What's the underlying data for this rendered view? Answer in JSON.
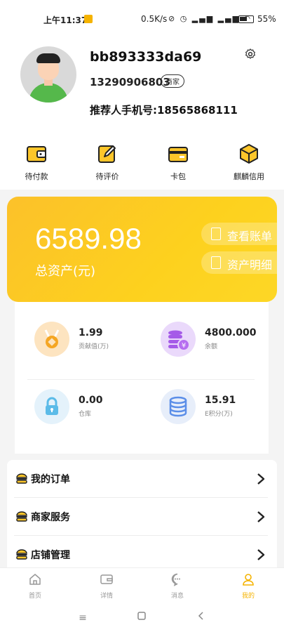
{
  "status_bar": {
    "time": "上午11:37",
    "network_speed": "0.5K/s",
    "battery": "55%"
  },
  "profile": {
    "username": "bb893333da69",
    "phone": "13290906803",
    "role_badge": "商家",
    "referrer": "推荐人手机号:18565868111"
  },
  "quick_actions": [
    {
      "label": "待付款",
      "icon": "wallet-icon"
    },
    {
      "label": "待评价",
      "icon": "edit-icon"
    },
    {
      "label": "卡包",
      "icon": "card-icon"
    },
    {
      "label": "麒麟信用",
      "icon": "box-icon"
    }
  ],
  "assets": {
    "total": "6589.98",
    "caption": "总资产(元)",
    "view_bill": "查看账单",
    "asset_detail": "资产明细"
  },
  "stats": [
    {
      "value": "1.99",
      "label": "贡献值(万)",
      "icon": "medal-icon",
      "color": "#fde4c0"
    },
    {
      "value": "4800.000",
      "label": "余额",
      "icon": "coins-icon",
      "color": "#ead9fb"
    },
    {
      "value": "0.00",
      "label": "仓库",
      "icon": "lock-icon",
      "color": "#e4f2fb"
    },
    {
      "value": "15.91",
      "label": "E积分(万)",
      "icon": "database-icon",
      "color": "#e7eefa"
    }
  ],
  "menu": [
    {
      "label": "我的订单"
    },
    {
      "label": "商家服务"
    },
    {
      "label": "店铺管理"
    }
  ],
  "tabs": [
    {
      "label": "首页"
    },
    {
      "label": "详情"
    },
    {
      "label": "消息"
    },
    {
      "label": "我的"
    }
  ],
  "colors": {
    "accent": "#fdc62a",
    "tab_active": "#f5b300"
  }
}
